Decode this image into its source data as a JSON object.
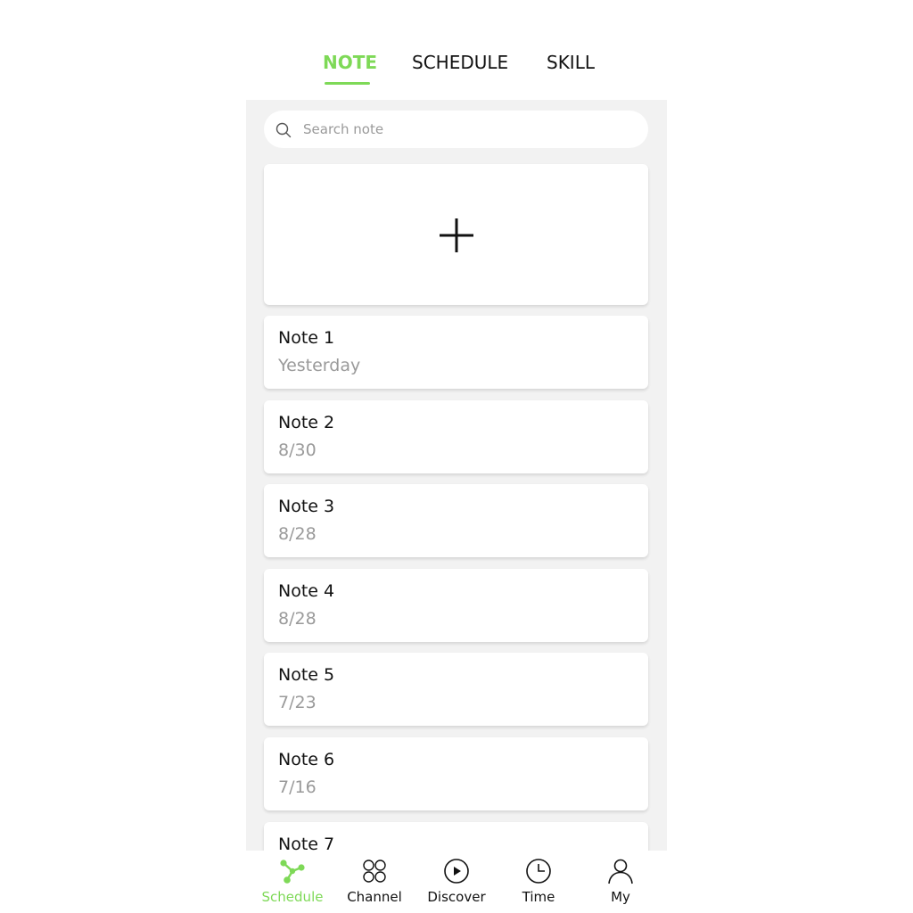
{
  "top_tabs": [
    {
      "label": "NOTE",
      "active": true
    },
    {
      "label": "SCHEDULE",
      "active": false
    },
    {
      "label": "SKILL",
      "active": false
    }
  ],
  "search": {
    "placeholder": "Search note",
    "value": "",
    "icon": "search-icon"
  },
  "add_card": {
    "icon": "plus-icon"
  },
  "notes": [
    {
      "title": "Note 1",
      "date": "Yesterday"
    },
    {
      "title": "Note 2",
      "date": "8/30"
    },
    {
      "title": "Note 3",
      "date": "8/28"
    },
    {
      "title": "Note 4",
      "date": "8/28"
    },
    {
      "title": "Note 5",
      "date": "7/23"
    },
    {
      "title": "Note 6",
      "date": "7/16"
    },
    {
      "title": "Note 7",
      "date": ""
    }
  ],
  "bottom_nav": [
    {
      "label": "Schedule",
      "icon": "schedule-nodes-icon",
      "active": true
    },
    {
      "label": "Channel",
      "icon": "channel-circles-icon",
      "active": false
    },
    {
      "label": "Discover",
      "icon": "play-circle-icon",
      "active": false
    },
    {
      "label": "Time",
      "icon": "clock-icon",
      "active": false
    },
    {
      "label": "My",
      "icon": "person-icon",
      "active": false
    }
  ],
  "colors": {
    "accent": "#7ed957",
    "panel_bg": "#f2f2f2",
    "text_primary": "#111111",
    "text_secondary": "#9a9a9a"
  }
}
